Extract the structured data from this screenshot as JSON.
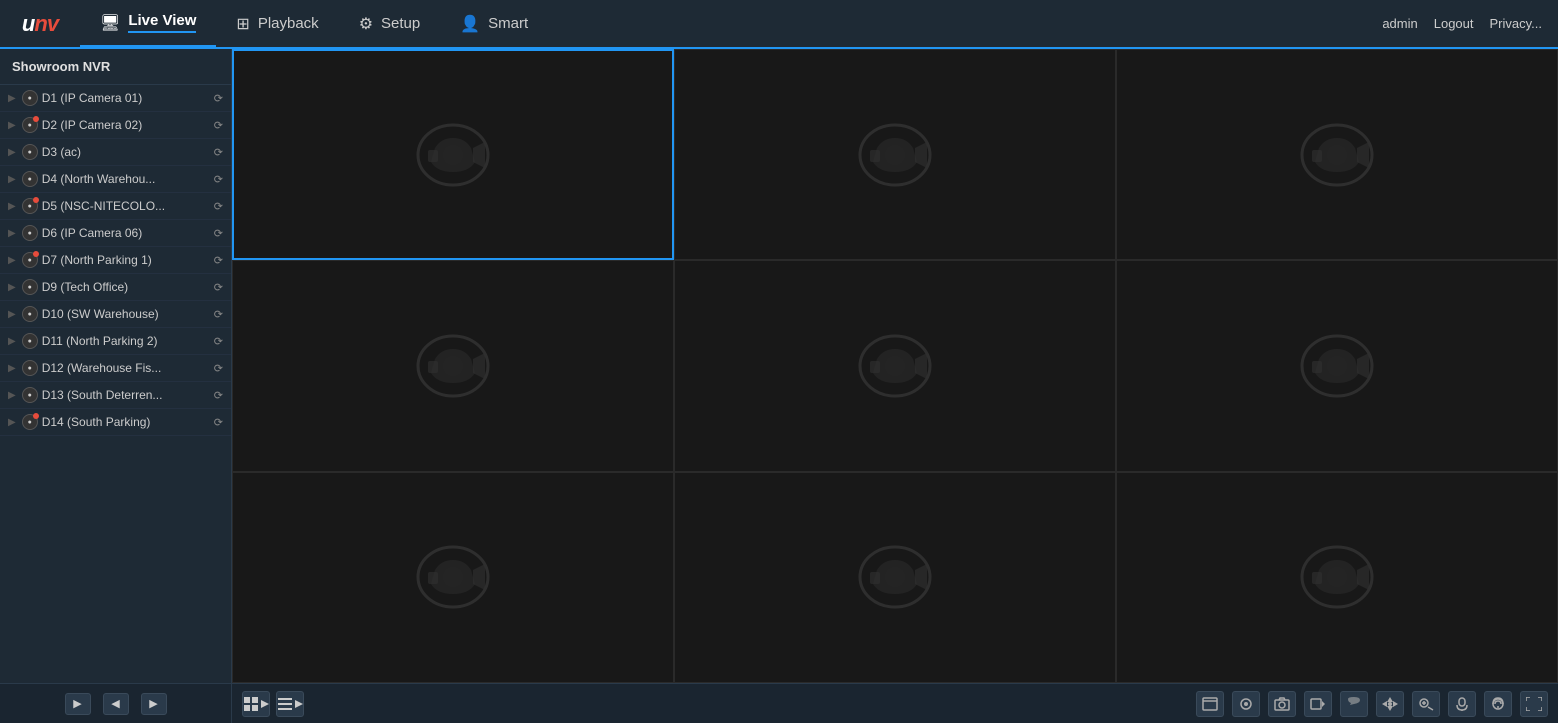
{
  "topbar": {
    "logo": "UNV",
    "nav": [
      {
        "id": "live-view",
        "label": "Live View",
        "icon": "🖥",
        "active": true
      },
      {
        "id": "playback",
        "label": "Playback",
        "icon": "⊞",
        "active": false
      },
      {
        "id": "setup",
        "label": "Setup",
        "icon": "⚙",
        "active": false
      },
      {
        "id": "smart",
        "label": "Smart",
        "icon": "👤",
        "active": false
      }
    ],
    "user": "admin",
    "logout": "Logout",
    "privacy": "Privacy..."
  },
  "sidebar": {
    "title": "Showroom NVR",
    "cameras": [
      {
        "id": "d1",
        "name": "D1 (IP Camera 01)",
        "alert": false,
        "ptz": true
      },
      {
        "id": "d2",
        "name": "D2 (IP Camera 02)",
        "alert": true,
        "ptz": true
      },
      {
        "id": "d3",
        "name": "D3 (ac)",
        "alert": false,
        "ptz": true
      },
      {
        "id": "d4",
        "name": "D4 (North Warehou...",
        "alert": false,
        "ptz": true
      },
      {
        "id": "d5",
        "name": "D5 (NSC-NITECOLO...",
        "alert": true,
        "ptz": true
      },
      {
        "id": "d6",
        "name": "D6 (IP Camera 06)",
        "alert": false,
        "ptz": true
      },
      {
        "id": "d7",
        "name": "D7 (North Parking 1)",
        "alert": true,
        "ptz": true
      },
      {
        "id": "d9",
        "name": "D9 (Tech Office)",
        "alert": false,
        "ptz": true
      },
      {
        "id": "d10",
        "name": "D10 (SW Warehouse)",
        "alert": false,
        "ptz": true
      },
      {
        "id": "d11",
        "name": "D11 (North Parking 2)",
        "alert": false,
        "ptz": true
      },
      {
        "id": "d12",
        "name": "D12 (Warehouse Fis...",
        "alert": false,
        "ptz": true
      },
      {
        "id": "d13",
        "name": "D13 (South Deterren...",
        "alert": false,
        "ptz": true
      },
      {
        "id": "d14",
        "name": "D14 (South Parking)",
        "alert": true,
        "ptz": true
      }
    ],
    "footer_buttons": [
      "prev",
      "nav1",
      "next"
    ]
  },
  "grid": {
    "cells": [
      {
        "id": 1,
        "active": true
      },
      {
        "id": 2,
        "active": false
      },
      {
        "id": 3,
        "active": false
      },
      {
        "id": 4,
        "active": false
      },
      {
        "id": 5,
        "active": false
      },
      {
        "id": 6,
        "active": false
      },
      {
        "id": 7,
        "active": false
      },
      {
        "id": 8,
        "active": false
      },
      {
        "id": 9,
        "active": false
      }
    ]
  },
  "toolbar": {
    "grid_layout_label": "⊞",
    "sequence_label": "≡",
    "icons_right": [
      "window-icon",
      "audio-icon",
      "snapshot-icon",
      "record-icon",
      "talk-icon",
      "ptz-icon",
      "zoom-icon",
      "mic-icon",
      "remote-icon",
      "fullscreen-icon"
    ]
  }
}
